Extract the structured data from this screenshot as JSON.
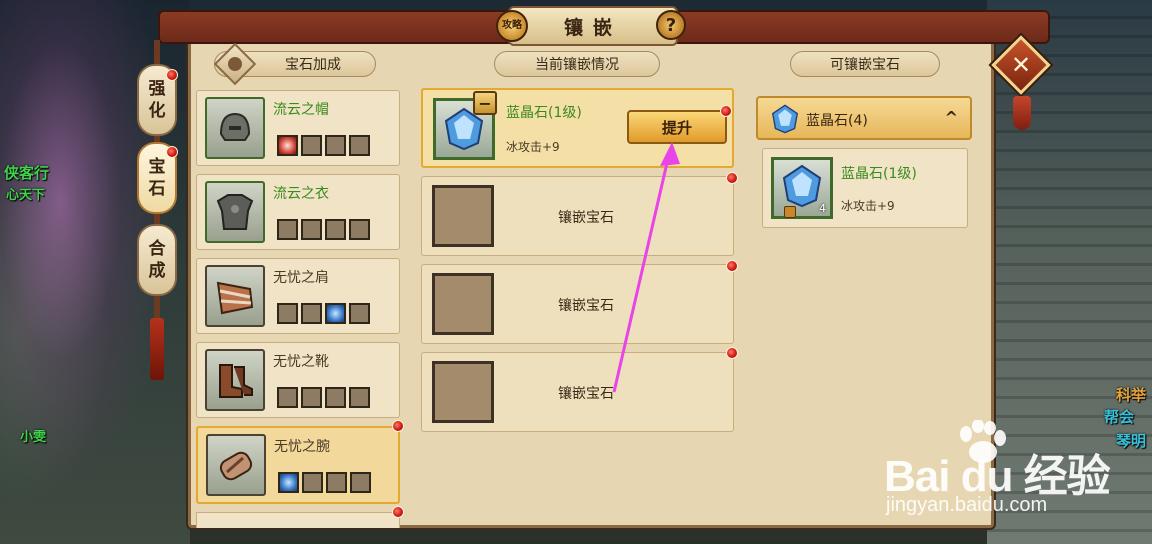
{
  "background": {
    "names": [
      "侠客行",
      "心天下",
      "小雯",
      "科举",
      "帮会",
      "琴明"
    ]
  },
  "window": {
    "title": "镶嵌",
    "guide_badge": "攻略",
    "help_label": "?",
    "close_label": "✕"
  },
  "side_tabs": [
    {
      "label_top": "强",
      "label_bottom": "化"
    },
    {
      "label_top": "宝",
      "label_bottom": "石"
    },
    {
      "label_top": "合",
      "label_bottom": "成"
    }
  ],
  "headers": {
    "bonus": "宝石加成",
    "current": "当前镶嵌情况",
    "available": "可镶嵌宝石"
  },
  "equipment": [
    {
      "name": "流云之帽",
      "slots": [
        "red",
        "",
        "",
        ""
      ]
    },
    {
      "name": "流云之衣",
      "slots": [
        "",
        "",
        "",
        ""
      ]
    },
    {
      "name": "无忧之肩",
      "slots": [
        "",
        "",
        "blue",
        ""
      ]
    },
    {
      "name": "无忧之靴",
      "slots": [
        "",
        "",
        "",
        ""
      ]
    },
    {
      "name": "无忧之腕",
      "slots": [
        "blue",
        "",
        "",
        ""
      ]
    }
  ],
  "current_slots": {
    "gem_name": "蓝晶石(1级)",
    "gem_attr": "冰攻击+9",
    "minus_label": "−",
    "upgrade_label": "提升",
    "empty_label": "镶嵌宝石"
  },
  "available_gems": {
    "group_label": "蓝晶石(4)",
    "group_toggle": "^",
    "item_name": "蓝晶石(1级)",
    "item_attr": "冰攻击+9",
    "item_qty": "4"
  },
  "watermark": {
    "brand": "Bai du 经验",
    "site": "jingyan.baidu.com"
  },
  "colors": {
    "panel": "#e7d6b2",
    "green_text": "#3a8a1d",
    "highlight_border": "#e3a930",
    "annotation_arrow": "#e844e8"
  }
}
